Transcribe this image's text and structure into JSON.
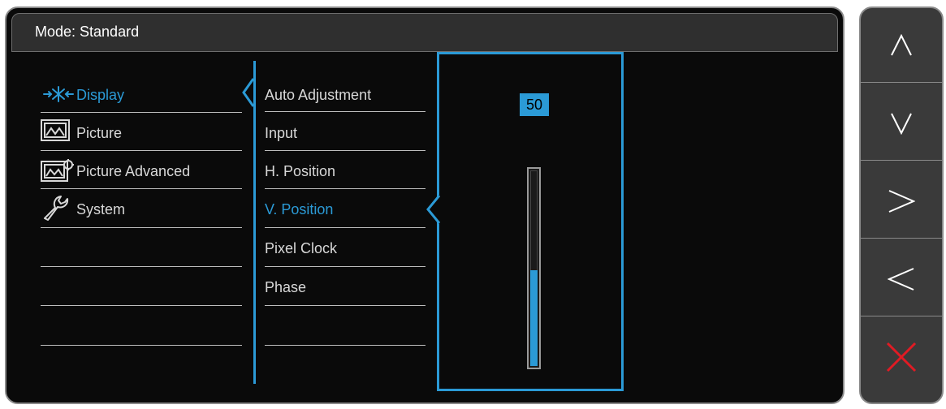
{
  "header": {
    "mode_label": "Mode: Standard"
  },
  "main_menu": {
    "items": [
      {
        "label": "Display",
        "icon": "display-icon",
        "active": true
      },
      {
        "label": "Picture",
        "icon": "picture-icon",
        "active": false
      },
      {
        "label": "Picture Advanced",
        "icon": "picture-advanced-icon",
        "active": false
      },
      {
        "label": "System",
        "icon": "wrench-icon",
        "active": false
      }
    ]
  },
  "sub_menu": {
    "items": [
      {
        "label": "Auto Adjustment",
        "active": false
      },
      {
        "label": "Input",
        "active": false
      },
      {
        "label": "H. Position",
        "active": false
      },
      {
        "label": "V. Position",
        "active": true
      },
      {
        "label": "Pixel Clock",
        "active": false
      },
      {
        "label": "Phase",
        "active": false
      }
    ]
  },
  "slider": {
    "value": "50",
    "level_fraction": 0.5
  },
  "buttons": [
    {
      "name": "up-button",
      "icon": "chevron-up-icon"
    },
    {
      "name": "down-button",
      "icon": "chevron-down-icon"
    },
    {
      "name": "right-button",
      "icon": "chevron-right-icon"
    },
    {
      "name": "left-button",
      "icon": "chevron-left-icon"
    },
    {
      "name": "close-button",
      "icon": "close-icon"
    }
  ],
  "colors": {
    "accent": "#2b9ad6",
    "close": "#e01b24",
    "panel": "#0a0a0a",
    "text": "#d8d8d8"
  }
}
